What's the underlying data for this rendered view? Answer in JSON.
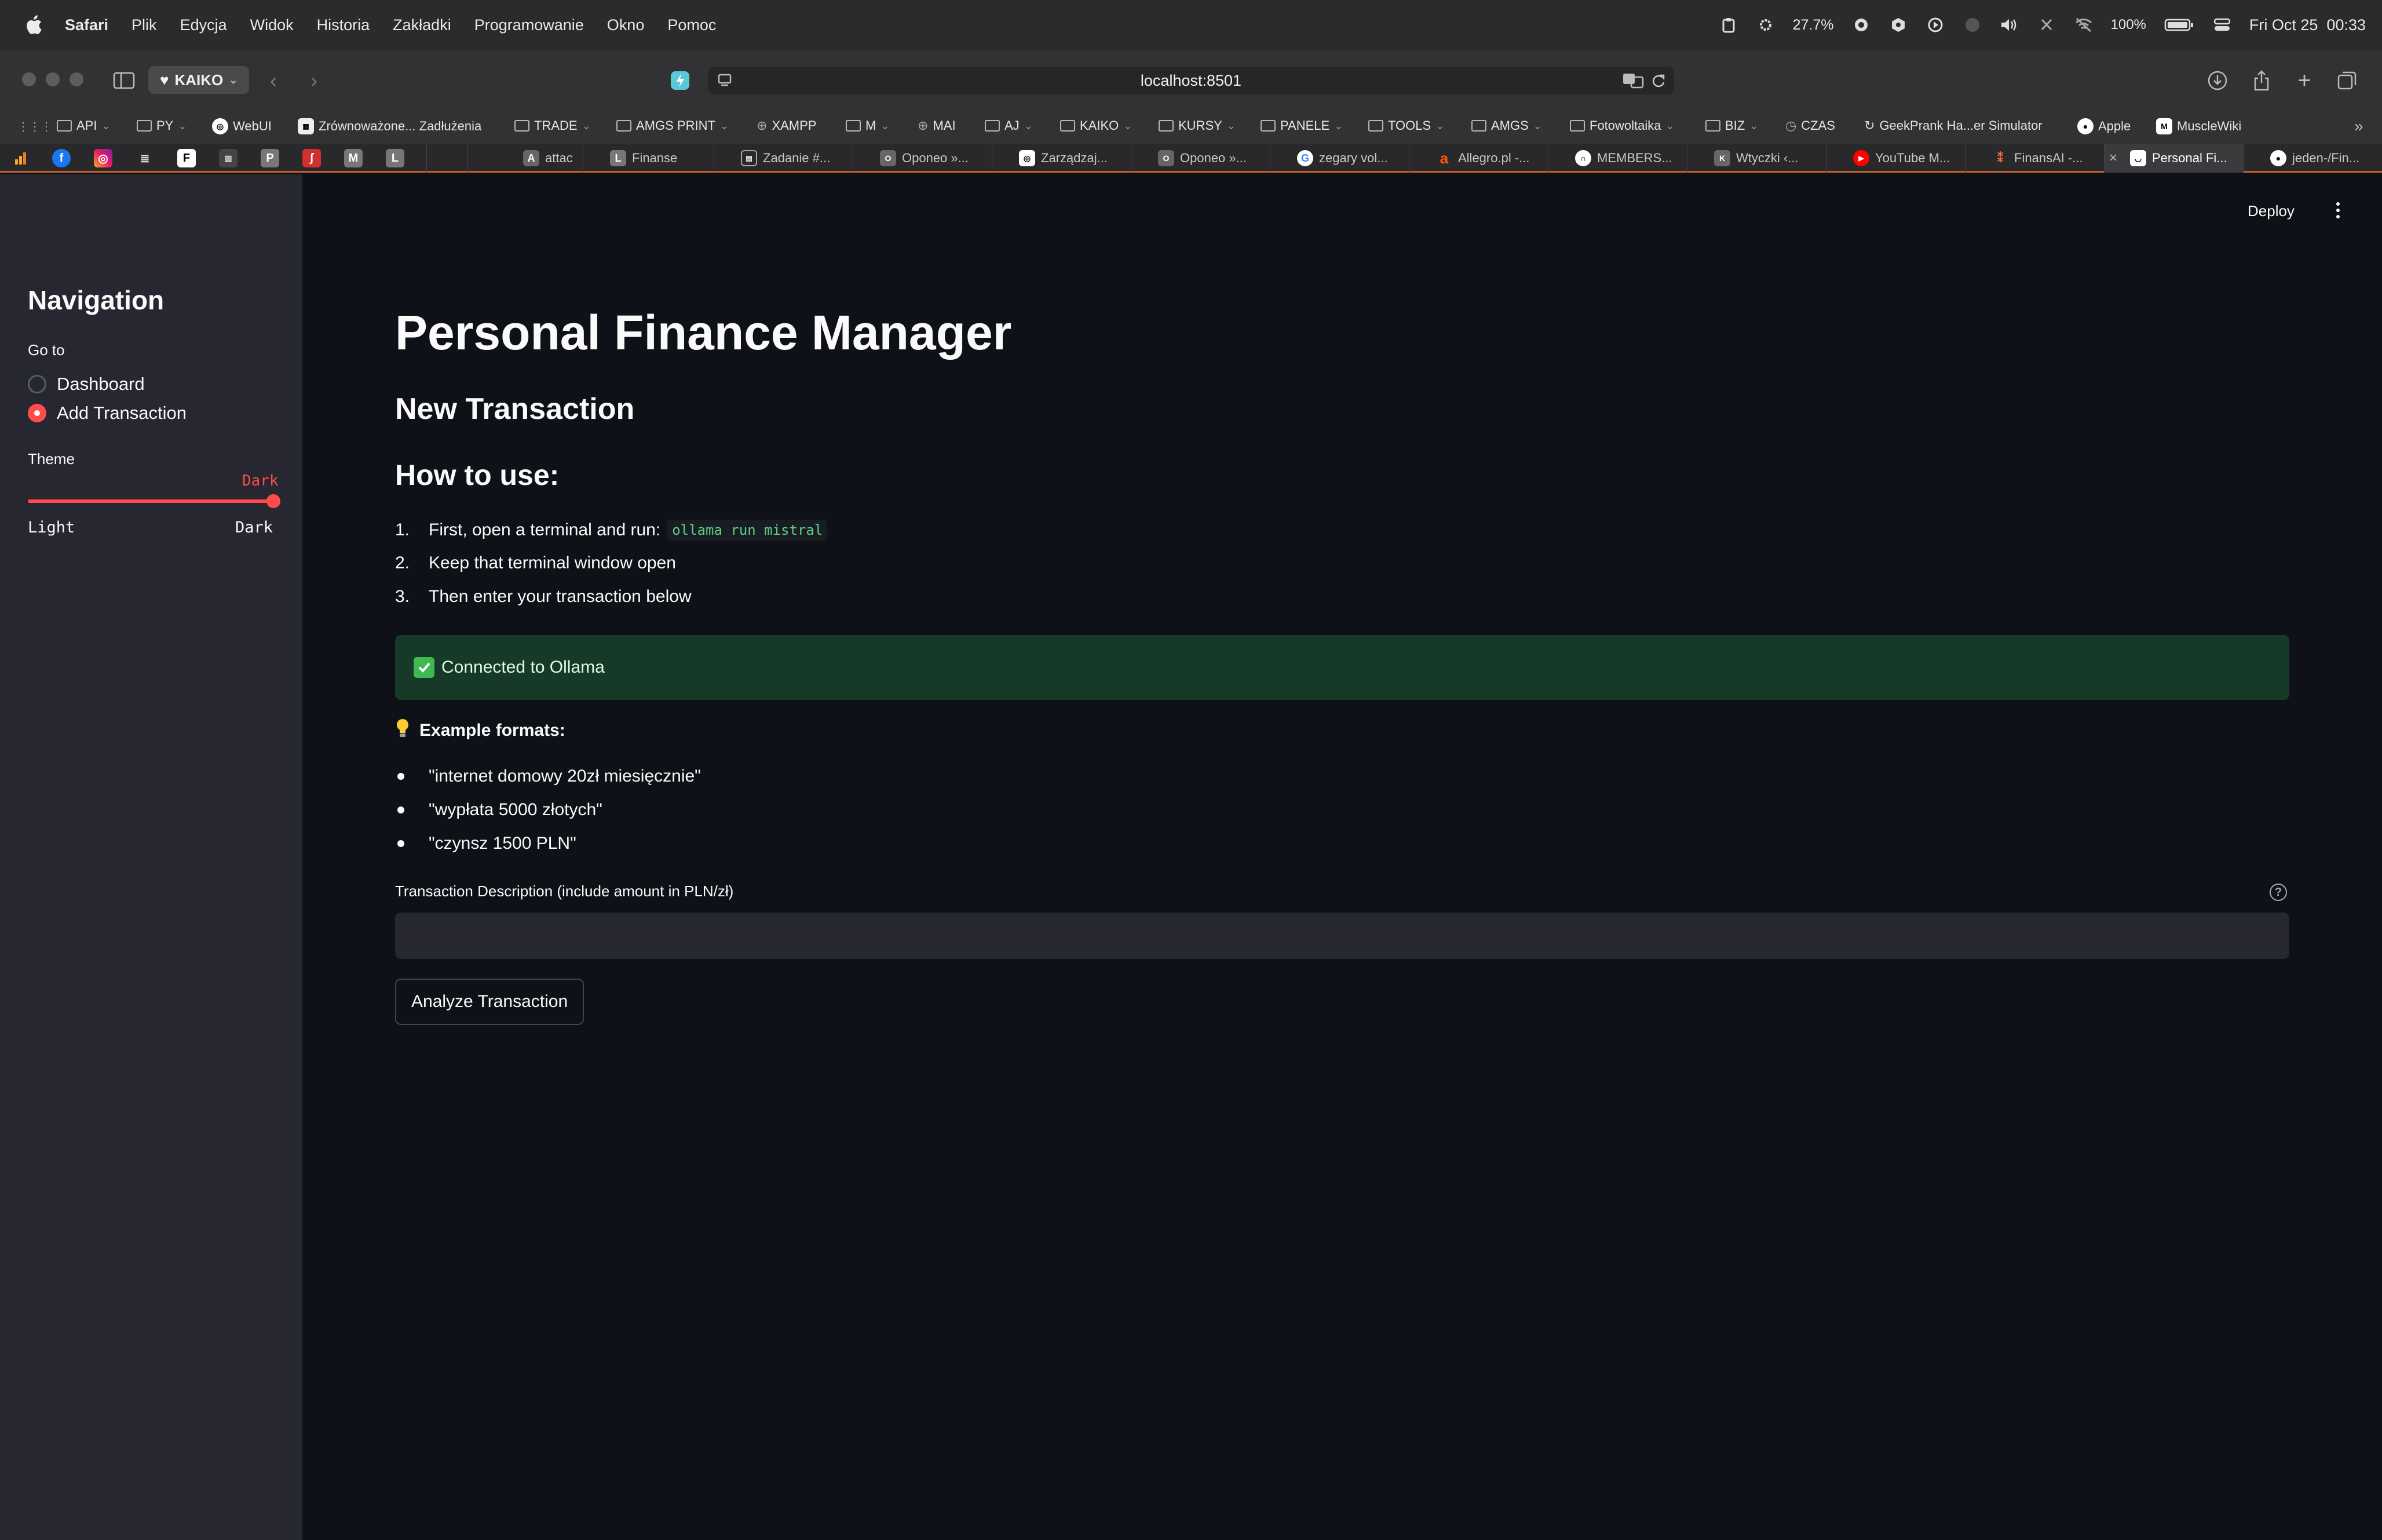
{
  "menubar": {
    "app": "Safari",
    "items": [
      "Plik",
      "Edycja",
      "Widok",
      "Historia",
      "Zakładki",
      "Programowanie",
      "Okno",
      "Pomoc"
    ],
    "cpu": "27.7%",
    "battery": "100%",
    "datetime": "Fri Oct 25  00:33"
  },
  "browser": {
    "profile": "KAIKO",
    "url": "localhost:8501",
    "bookmarks": [
      "API",
      "PY",
      "WebUI",
      "Zrównoważone... Zadłużenia",
      "TRADE",
      "AMGS PRINT",
      "XAMPP",
      "M",
      "MAI",
      "AJ",
      "KAIKO",
      "KURSY",
      "PANELE",
      "TOOLS",
      "AMGS",
      "Fotowoltaika",
      "BIZ",
      "CZAS",
      "GeekPrank Ha...er Simulator",
      "Apple",
      "MuscleWiki"
    ],
    "pinned": [
      "F",
      "P",
      "M",
      "L"
    ],
    "tabs": [
      "attac",
      "Finanse",
      "Zadanie #...",
      "Oponeo »...",
      "Zarządzaj...",
      "Oponeo »...",
      "zegary vol...",
      "Allegro.pl -...",
      "MEMBERS...",
      "Wtyczki ‹...",
      "YouTube M...",
      "FinansAI -...",
      "Personal Fi...",
      "jeden-/Fin..."
    ]
  },
  "sidebar": {
    "title": "Navigation",
    "goto_label": "Go to",
    "options": [
      "Dashboard",
      "Add Transaction"
    ],
    "selected": "Add Transaction",
    "theme_label": "Theme",
    "theme_value": "Dark",
    "theme_min": "Light",
    "theme_max": "Dark",
    "theme_level": 1.0
  },
  "header": {
    "deploy": "Deploy"
  },
  "main": {
    "title": "Personal Finance Manager",
    "subtitle": "New Transaction",
    "howto_heading": "How to use:",
    "steps": [
      {
        "num": "1.",
        "text": "First, open a terminal and run:",
        "code": "ollama run mistral"
      },
      {
        "num": "2.",
        "text": "Keep that terminal window open"
      },
      {
        "num": "3.",
        "text": "Then enter your transaction below"
      }
    ],
    "status": "Connected to Ollama",
    "examples_heading": "Example formats:",
    "examples": [
      "\"internet domowy 20zł miesięcznie\"",
      "\"wypłata 5000 złotych\"",
      "\"czynsz 1500 PLN\""
    ],
    "input_label": "Transaction Description (include amount in PLN/zł)",
    "input_value": "",
    "button": "Analyze Transaction"
  },
  "colors": {
    "accent": "#ff4b4b",
    "background": "#0e1117",
    "sidebar": "#262730",
    "success_bg": "#173928"
  }
}
